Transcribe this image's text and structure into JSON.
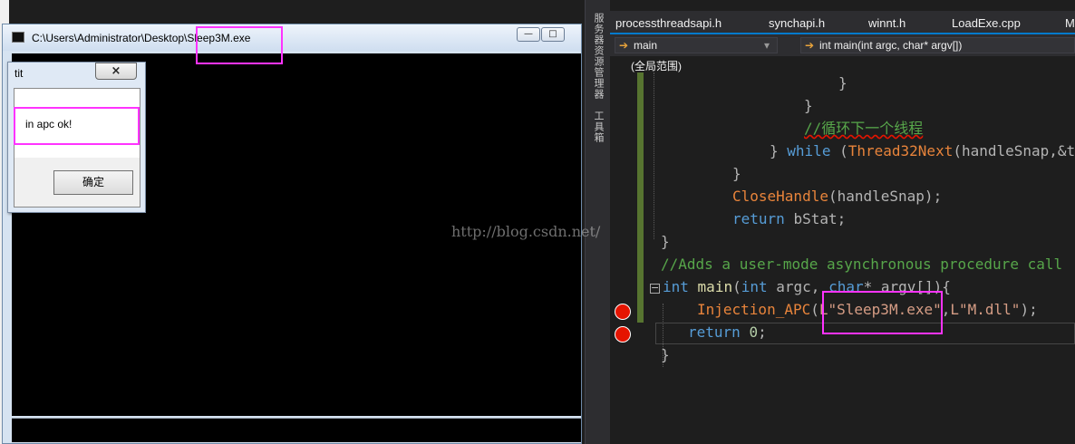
{
  "console": {
    "title": "C:\\Users\\Administrator\\Desktop\\Sleep3M.exe",
    "minimize_glyph": "—",
    "maximize_glyph": "□"
  },
  "message_box": {
    "title": "tit",
    "close_glyph": "×",
    "text": "in apc ok!",
    "ok_label": "确定"
  },
  "ide": {
    "side_tabs": [
      "服务器资源管理器",
      "工具箱"
    ],
    "tabs": [
      "processthreadsapi.h",
      "synchapi.h",
      "winnt.h",
      "LoadExe.cpp",
      "M"
    ],
    "nav": {
      "scope_icon": "➔",
      "scope": "main",
      "member_icon": "➔",
      "member": "int main(int argc, char* argv[])",
      "dropdown_glyph": "▾",
      "scope_hint": "(全局范围)"
    },
    "code": {
      "l1_brace": "}",
      "l2_brace": "}",
      "l3_comment": "//循环下一个线程",
      "l4_close": "}",
      "l4_kw": "while",
      "l4_open": "(",
      "l4_fn": "Thread32Next",
      "l4_args": "(handleSnap,&t",
      "l5_brace": "}",
      "l6_fn": "CloseHandle",
      "l6_args": "(handleSnap);",
      "l7_kw": "return",
      "l7_rest": "bStat;",
      "l8_brace": "}",
      "l9_comment": "//Adds a user-mode asynchronous procedure call",
      "l10_kw1": "int",
      "l10_fn": "main",
      "l10_open": "(",
      "l10_kw2": "int",
      "l10_mid": "argc,",
      "l10_kw3": "char",
      "l10_end": "* argv[]){",
      "l11_fn": "Injection_APC",
      "l11_open": "(",
      "l11_s1": "L\"Sleep3M.exe\"",
      "l11_comma": ",",
      "l11_s2": "L\"M.dll\"",
      "l11_end": ");",
      "l12_kw": "return",
      "l12_num": "0",
      "l12_end": ";",
      "l13_brace": "}",
      "fold_glyph": "−"
    },
    "watermark": "http://blog.csdn.net/"
  }
}
